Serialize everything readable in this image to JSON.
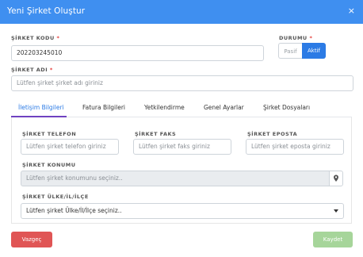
{
  "modal": {
    "title": "Yeni Şirket Oluştur",
    "close": "×"
  },
  "fields": {
    "company_code": {
      "label": "ŞİRKET KODU",
      "required": "*",
      "value": "202203245010"
    },
    "status": {
      "label": "DURUMU",
      "required": "*",
      "options": [
        "Pasif",
        "Aktif"
      ],
      "selected": "Aktif"
    },
    "company_name": {
      "label": "ŞİRKET ADI",
      "required": "*",
      "placeholder": "Lütfen şirket şirket adı giriniz"
    }
  },
  "tabs": [
    {
      "label": "İletişim Bilgileri",
      "active": true
    },
    {
      "label": "Fatura Bilgileri",
      "active": false
    },
    {
      "label": "Yetkilendirme",
      "active": false
    },
    {
      "label": "Genel Ayarlar",
      "active": false
    },
    {
      "label": "Şirket Dosyaları",
      "active": false
    }
  ],
  "contact": {
    "phone": {
      "label": "ŞİRKET TELEFON",
      "placeholder": "Lütfen şirket telefon giriniz"
    },
    "fax": {
      "label": "ŞİRKET FAKS",
      "placeholder": "Lütfen şirket faks giriniz"
    },
    "email": {
      "label": "ŞİRKET EPOSTA",
      "placeholder": "Lütfen şirket eposta giriniz"
    },
    "location": {
      "label": "ŞİRKET KONUMU",
      "placeholder": "Lütfen  şirket konumunu seçiniz..",
      "icon": "map-marker-icon"
    },
    "country": {
      "label": "ŞİRKET ÜLKE/İL/İLÇE",
      "value": "Lütfen şirket Ülke/İl/İlçe seçiniz.."
    }
  },
  "footer": {
    "cancel": "Vazgeç",
    "save": "Kaydet"
  },
  "colors": {
    "header": "#3f8ff0",
    "active_toggle": "#2c7be5",
    "cancel": "#e05555",
    "save": "#a6d59a",
    "required": "#e53935"
  }
}
